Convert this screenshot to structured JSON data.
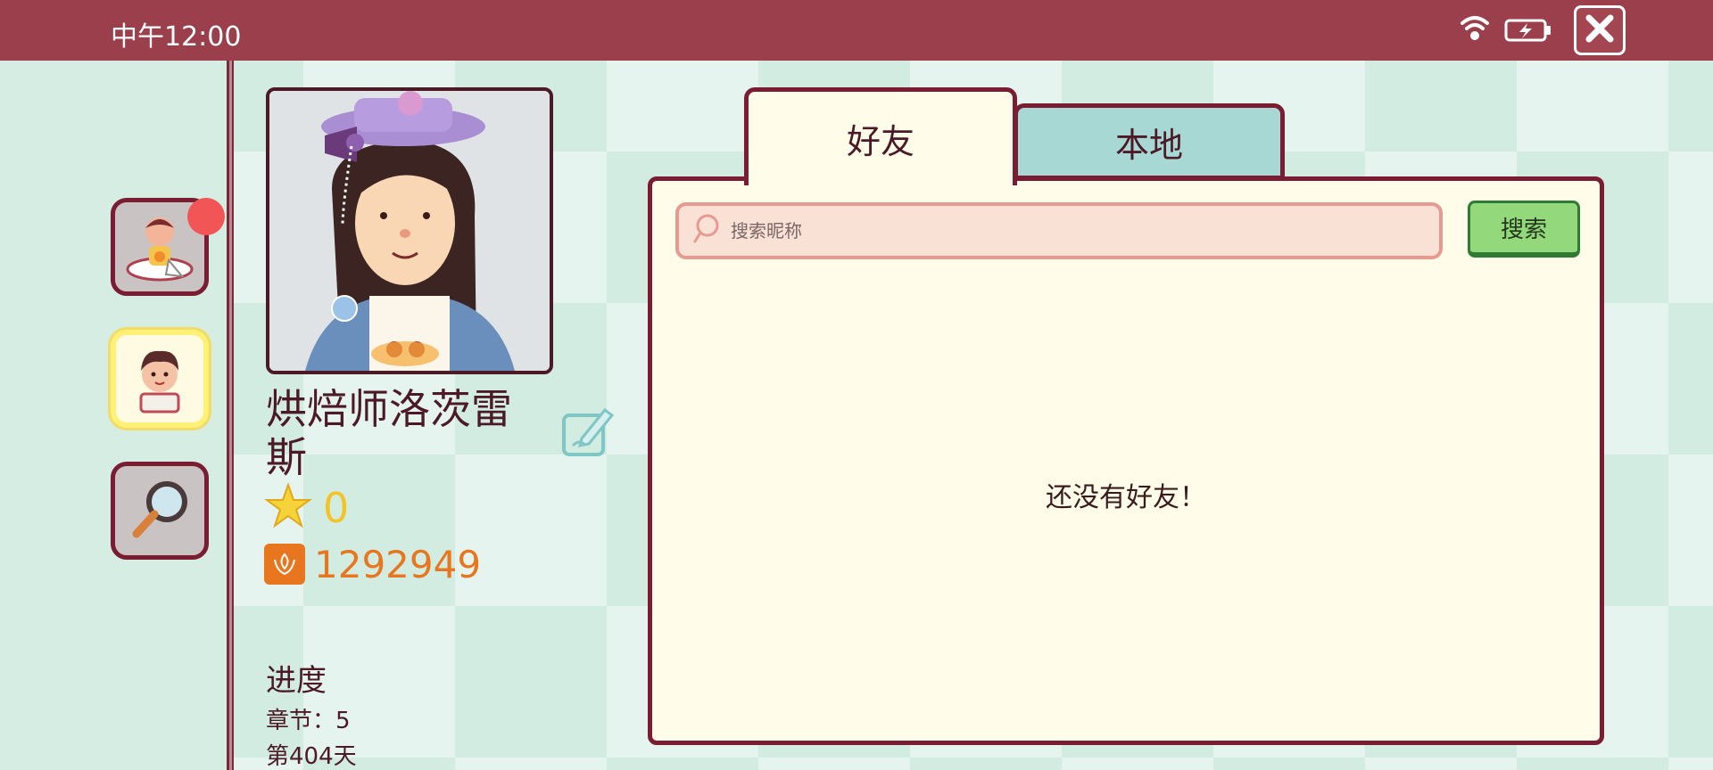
{
  "status_bar": {
    "time": "中午12:00",
    "icons": [
      "wifi-icon",
      "battery-charging-icon"
    ],
    "close_icon": "close-icon"
  },
  "sidebar": {
    "items": [
      {
        "name": "customer-avatar-button",
        "icon": "customer-avatar-icon",
        "notification": true
      },
      {
        "name": "friends-avatar-button",
        "icon": "boy-avatar-icon",
        "active": true
      },
      {
        "name": "search-magnifier-button",
        "icon": "magnifier-icon"
      }
    ]
  },
  "profile": {
    "name": "烘焙师洛茨雷斯",
    "stars": "0",
    "coins": "1292949",
    "progress_title": "进度",
    "chapter": "章节：5",
    "day": "第404天"
  },
  "tabs": [
    {
      "label": "好友",
      "selected": true
    },
    {
      "label": "本地",
      "selected": false
    }
  ],
  "search": {
    "placeholder": "搜索昵称",
    "button_label": "搜索"
  },
  "panel": {
    "empty_message": "还没有好友！"
  },
  "colors": {
    "topbar": "#9a3f4b",
    "border": "#7a1d33",
    "panel_bg": "#fffdea",
    "local_tab": "#a8d8d4",
    "search_button": "#93d87a",
    "coin": "#e8761e",
    "star": "#f2c428"
  }
}
